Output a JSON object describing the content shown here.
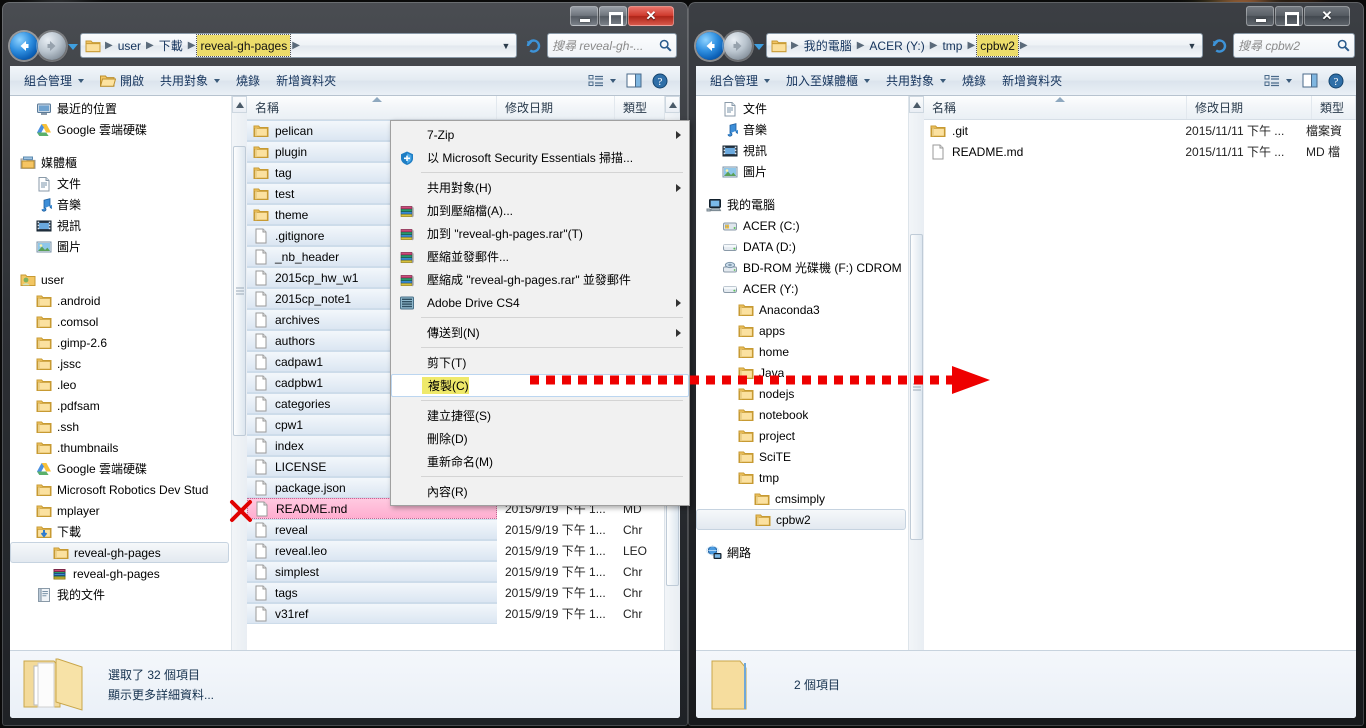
{
  "left_window": {
    "title": "reveal-gh-pages",
    "caption": {
      "minimize": "—",
      "maximize": "□",
      "close": "✕"
    },
    "address": {
      "crumbs": [
        "user",
        "下載",
        "reveal-gh-pages"
      ],
      "highlight_index": 2,
      "dropdown": "▼",
      "refresh": "refresh-icon"
    },
    "search": {
      "placeholder": "搜尋 reveal-gh-..."
    },
    "toolbar": [
      {
        "label": "組合管理",
        "caret": true,
        "icon": ""
      },
      {
        "label": "開啟",
        "caret": false,
        "icon": "open-folder-icon"
      },
      {
        "label": "共用對象",
        "caret": true,
        "icon": ""
      },
      {
        "label": "燒錄",
        "caret": false,
        "icon": ""
      },
      {
        "label": "新增資料夾",
        "caret": false,
        "icon": ""
      }
    ],
    "toolbar_right": [
      "view-layout-icon",
      "preview-pane-icon",
      "help-icon"
    ],
    "nav_tree": [
      {
        "label": "最近的位置",
        "icon": "recent-icon",
        "indent": 1
      },
      {
        "label": "Google 雲端硬碟",
        "icon": "gdrive-icon",
        "indent": 1
      },
      {
        "spacer": true
      },
      {
        "label": "媒體櫃",
        "icon": "library-icon",
        "indent": 0
      },
      {
        "label": "文件",
        "icon": "document-icon",
        "indent": 1
      },
      {
        "label": "音樂",
        "icon": "music-icon",
        "indent": 1
      },
      {
        "label": "視訊",
        "icon": "video-icon",
        "indent": 1
      },
      {
        "label": "圖片",
        "icon": "picture-icon",
        "indent": 1
      },
      {
        "spacer": true
      },
      {
        "label": "user",
        "icon": "user-folder-icon",
        "indent": 0
      },
      {
        "label": ".android",
        "icon": "folder-icon",
        "indent": 1
      },
      {
        "label": ".comsol",
        "icon": "folder-icon",
        "indent": 1
      },
      {
        "label": ".gimp-2.6",
        "icon": "folder-icon",
        "indent": 1
      },
      {
        "label": ".jssc",
        "icon": "folder-icon",
        "indent": 1
      },
      {
        "label": ".leo",
        "icon": "folder-icon",
        "indent": 1
      },
      {
        "label": ".pdfsam",
        "icon": "folder-icon",
        "indent": 1
      },
      {
        "label": ".ssh",
        "icon": "folder-icon",
        "indent": 1
      },
      {
        "label": ".thumbnails",
        "icon": "folder-icon",
        "indent": 1
      },
      {
        "label": "Google 雲端硬碟",
        "icon": "gdrive-icon",
        "indent": 1
      },
      {
        "label": "Microsoft Robotics Dev Stud",
        "icon": "folder-icon",
        "indent": 1
      },
      {
        "label": "mplayer",
        "icon": "folder-icon",
        "indent": 1
      },
      {
        "label": "下載",
        "icon": "download-folder-icon",
        "indent": 1
      },
      {
        "label": "reveal-gh-pages",
        "icon": "folder-icon",
        "indent": 2,
        "selected": true
      },
      {
        "label": "reveal-gh-pages",
        "icon": "rar-icon",
        "indent": 2
      },
      {
        "label": "我的文件",
        "icon": "mydocs-icon",
        "indent": 1
      }
    ],
    "columns": [
      "名稱",
      "修改日期",
      "類型"
    ],
    "files": [
      {
        "name": "pelican",
        "icon": "folder-icon",
        "date": "",
        "type": "",
        "selected": true
      },
      {
        "name": "plugin",
        "icon": "folder-icon",
        "date": "",
        "type": "",
        "selected": true
      },
      {
        "name": "tag",
        "icon": "folder-icon",
        "date": "",
        "type": "",
        "selected": true
      },
      {
        "name": "test",
        "icon": "folder-icon",
        "date": "",
        "type": "",
        "selected": true
      },
      {
        "name": "theme",
        "icon": "folder-icon",
        "date": "",
        "type": "",
        "selected": true
      },
      {
        "name": ".gitignore",
        "icon": "file-icon",
        "date": "",
        "type": "",
        "selected": true
      },
      {
        "name": "_nb_header",
        "icon": "file-icon",
        "date": "",
        "type": "",
        "selected": true
      },
      {
        "name": "2015cp_hw_w1",
        "icon": "file-icon",
        "date": "",
        "type": "",
        "selected": true
      },
      {
        "name": "2015cp_note1",
        "icon": "file-icon",
        "date": "",
        "type": "",
        "selected": true
      },
      {
        "name": "archives",
        "icon": "file-icon",
        "date": "",
        "type": "",
        "selected": true
      },
      {
        "name": "authors",
        "icon": "file-icon",
        "date": "",
        "type": "",
        "selected": true
      },
      {
        "name": "cadpaw1",
        "icon": "file-icon",
        "date": "",
        "type": "",
        "selected": true
      },
      {
        "name": "cadpbw1",
        "icon": "file-icon",
        "date": "",
        "type": "",
        "selected": true
      },
      {
        "name": "categories",
        "icon": "file-icon",
        "date": "",
        "type": "",
        "selected": true
      },
      {
        "name": "cpw1",
        "icon": "file-icon",
        "date": "",
        "type": "",
        "selected": true
      },
      {
        "name": "index",
        "icon": "file-icon",
        "date": "",
        "type": "",
        "selected": true
      },
      {
        "name": "LICENSE",
        "icon": "file-icon",
        "date": "",
        "type": "",
        "selected": true
      },
      {
        "name": "package.json",
        "icon": "file-icon",
        "date": "",
        "type": "",
        "selected": true
      },
      {
        "name": "README.md",
        "icon": "file-icon",
        "date": "2015/9/19 下午 1...",
        "type": "MD",
        "pink": true
      },
      {
        "name": "reveal",
        "icon": "file-icon",
        "date": "2015/9/19 下午 1...",
        "type": "Chr",
        "selected": true
      },
      {
        "name": "reveal.leo",
        "icon": "file-icon",
        "date": "2015/9/19 下午 1...",
        "type": "LEO",
        "selected": true
      },
      {
        "name": "simplest",
        "icon": "file-icon",
        "date": "2015/9/19 下午 1...",
        "type": "Chr",
        "selected": true
      },
      {
        "name": "tags",
        "icon": "file-icon",
        "date": "2015/9/19 下午 1...",
        "type": "Chr",
        "selected": true
      },
      {
        "name": "v31ref",
        "icon": "file-icon",
        "date": "2015/9/19 下午 1...",
        "type": "Chr",
        "selected": true
      }
    ],
    "status": {
      "line1": "選取了 32 個項目",
      "line2": "顯示更多詳細資料..."
    }
  },
  "context_menu": {
    "items": [
      {
        "label": "7-Zip",
        "icon": "",
        "submenu": true
      },
      {
        "label": "以 Microsoft Security Essentials 掃描...",
        "icon": "mse-icon",
        "submenu": false
      },
      {
        "separator": true
      },
      {
        "label": "共用對象(H)",
        "icon": "",
        "submenu": true
      },
      {
        "label": "加到壓縮檔(A)...",
        "icon": "winrar-icon",
        "submenu": false
      },
      {
        "label": "加到 \"reveal-gh-pages.rar\"(T)",
        "icon": "winrar-icon",
        "submenu": false
      },
      {
        "label": "壓縮並發郵件...",
        "icon": "winrar-icon",
        "submenu": false
      },
      {
        "label": "壓縮成 \"reveal-gh-pages.rar\" 並發郵件",
        "icon": "winrar-icon",
        "submenu": false
      },
      {
        "label": "Adobe Drive CS4",
        "icon": "adobe-icon",
        "submenu": true
      },
      {
        "separator": true
      },
      {
        "label": "傳送到(N)",
        "icon": "",
        "submenu": true
      },
      {
        "separator": true
      },
      {
        "label": "剪下(T)",
        "icon": "",
        "submenu": false
      },
      {
        "label": "複製(C)",
        "icon": "",
        "submenu": false,
        "highlight": true
      },
      {
        "separator": true
      },
      {
        "label": "建立捷徑(S)",
        "icon": "",
        "submenu": false
      },
      {
        "label": "刪除(D)",
        "icon": "",
        "submenu": false
      },
      {
        "label": "重新命名(M)",
        "icon": "",
        "submenu": false
      },
      {
        "separator": true
      },
      {
        "label": "內容(R)",
        "icon": "",
        "submenu": false
      }
    ]
  },
  "right_window": {
    "title": "cpbw2",
    "caption": {
      "minimize": "—",
      "maximize": "□",
      "close": "✕"
    },
    "address": {
      "crumbs": [
        "我的電腦",
        "ACER (Y:)",
        "tmp",
        "cpbw2"
      ],
      "highlight_index": 3,
      "dropdown": "▼",
      "refresh": "refresh-icon"
    },
    "search": {
      "placeholder": "搜尋 cpbw2"
    },
    "toolbar": [
      {
        "label": "組合管理",
        "caret": true
      },
      {
        "label": "加入至媒體櫃",
        "caret": true
      },
      {
        "label": "共用對象",
        "caret": true
      },
      {
        "label": "燒錄",
        "caret": false
      },
      {
        "label": "新增資料夾",
        "caret": false
      }
    ],
    "toolbar_right": [
      "view-layout-icon",
      "preview-pane-icon",
      "help-icon"
    ],
    "nav_tree": [
      {
        "label": "文件",
        "icon": "document-icon",
        "indent": 1
      },
      {
        "label": "音樂",
        "icon": "music-icon",
        "indent": 1
      },
      {
        "label": "視訊",
        "icon": "video-icon",
        "indent": 1
      },
      {
        "label": "圖片",
        "icon": "picture-icon",
        "indent": 1
      },
      {
        "spacer": true
      },
      {
        "label": "我的電腦",
        "icon": "computer-icon",
        "indent": 0
      },
      {
        "label": "ACER (C:)",
        "icon": "sysdrive-icon",
        "indent": 1
      },
      {
        "label": "DATA (D:)",
        "icon": "drive-icon",
        "indent": 1
      },
      {
        "label": "BD-ROM 光碟機 (F:) CDROM",
        "icon": "optical-drive-icon",
        "indent": 1
      },
      {
        "label": "ACER (Y:)",
        "icon": "drive-icon",
        "indent": 1
      },
      {
        "label": "Anaconda3",
        "icon": "folder-icon",
        "indent": 2
      },
      {
        "label": "apps",
        "icon": "folder-icon",
        "indent": 2
      },
      {
        "label": "home",
        "icon": "folder-icon",
        "indent": 2
      },
      {
        "label": "Java",
        "icon": "folder-icon",
        "indent": 2
      },
      {
        "label": "nodejs",
        "icon": "folder-icon",
        "indent": 2
      },
      {
        "label": "notebook",
        "icon": "folder-icon",
        "indent": 2
      },
      {
        "label": "project",
        "icon": "folder-icon",
        "indent": 2
      },
      {
        "label": "SciTE",
        "icon": "folder-icon",
        "indent": 2
      },
      {
        "label": "tmp",
        "icon": "folder-icon",
        "indent": 2
      },
      {
        "label": "cmsimply",
        "icon": "folder-icon",
        "indent": 3
      },
      {
        "label": "cpbw2",
        "icon": "folder-icon",
        "indent": 3,
        "selected": true
      },
      {
        "spacer": true
      },
      {
        "label": "網路",
        "icon": "network-icon",
        "indent": 0
      }
    ],
    "columns": [
      "名稱",
      "修改日期",
      "類型"
    ],
    "files": [
      {
        "name": ".git",
        "icon": "folder-icon",
        "date": "2015/11/11 下午 ...",
        "type": "檔案資"
      },
      {
        "name": "README.md",
        "icon": "file-icon",
        "date": "2015/11/11 下午 ...",
        "type": "MD 檔"
      }
    ],
    "status": {
      "line1": "2 個項目",
      "line2": ""
    }
  },
  "annotations": {
    "red_x": "✕",
    "arrow": "red-dashed-arrow",
    "arrow_color": "#ee0000"
  }
}
